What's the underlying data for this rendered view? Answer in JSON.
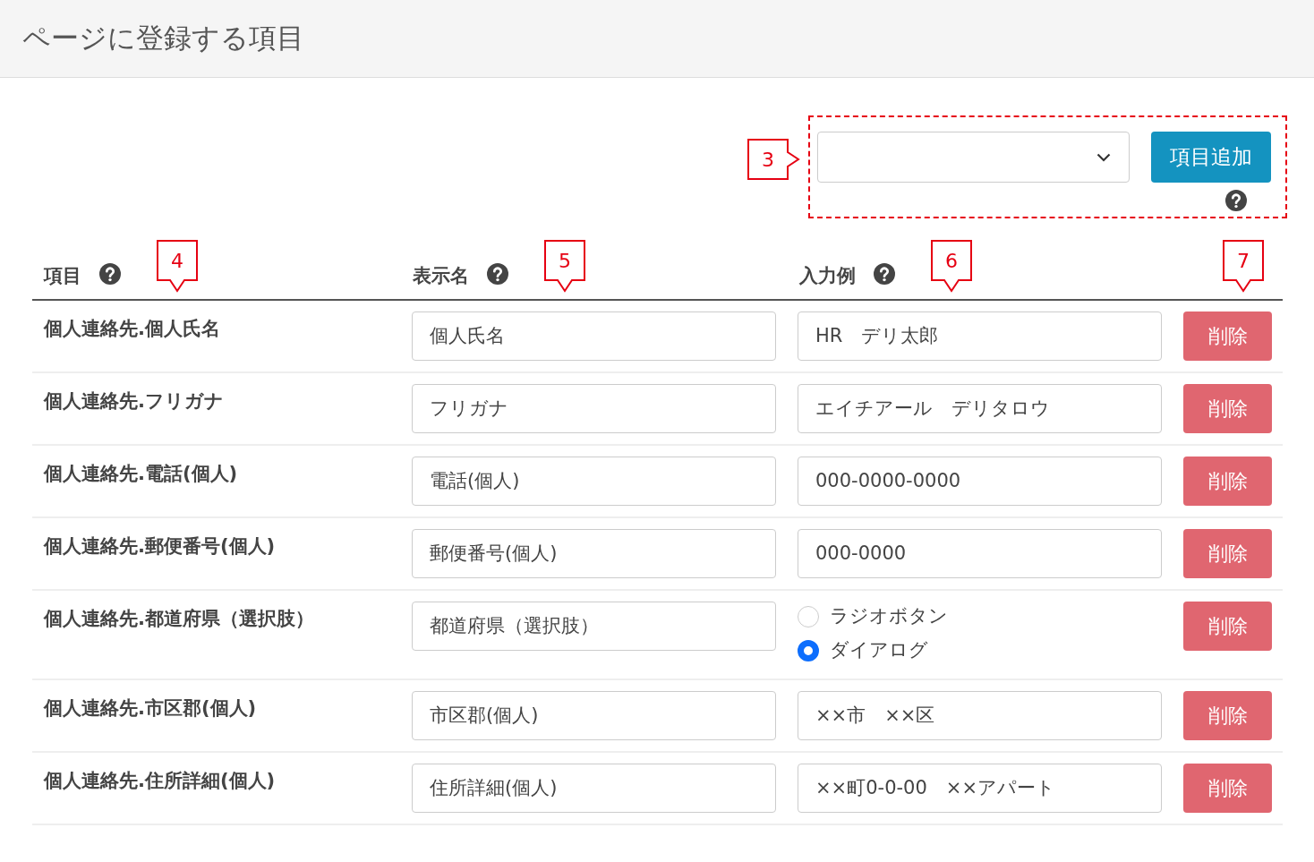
{
  "header": {
    "title": "ページに登録する項目"
  },
  "toolbar": {
    "annotation": "3",
    "add_button": "項目追加"
  },
  "columns": [
    {
      "label": "項目",
      "annotation": "4"
    },
    {
      "label": "表示名",
      "annotation": "5"
    },
    {
      "label": "入力例",
      "annotation": "6"
    },
    {
      "annotation": "7"
    }
  ],
  "rows": [
    {
      "item": "個人連絡先.個人氏名",
      "display_name": "個人氏名",
      "example": {
        "kind": "text",
        "value": "HR　デリ太郎"
      },
      "delete": "削除"
    },
    {
      "item": "個人連絡先.フリガナ",
      "display_name": "フリガナ",
      "example": {
        "kind": "text",
        "value": "エイチアール　デリタロウ"
      },
      "delete": "削除"
    },
    {
      "item": "個人連絡先.電話(個人)",
      "display_name": "電話(個人)",
      "example": {
        "kind": "text",
        "value": "000-0000-0000"
      },
      "delete": "削除"
    },
    {
      "item": "個人連絡先.郵便番号(個人)",
      "display_name": "郵便番号(個人)",
      "example": {
        "kind": "text",
        "value": "000-0000"
      },
      "delete": "削除"
    },
    {
      "item": "個人連絡先.都道府県（選択肢）",
      "display_name": "都道府県（選択肢）",
      "example": {
        "kind": "radio",
        "options": [
          {
            "label": "ラジオボタン",
            "selected": false
          },
          {
            "label": "ダイアログ",
            "selected": true
          }
        ]
      },
      "delete": "削除"
    },
    {
      "item": "個人連絡先.市区郡(個人)",
      "display_name": "市区郡(個人)",
      "example": {
        "kind": "text",
        "value": "××市　××区"
      },
      "delete": "削除"
    },
    {
      "item": "個人連絡先.住所詳細(個人)",
      "display_name": "住所詳細(個人)",
      "example": {
        "kind": "text",
        "value": "××町0-0-00　××アパート"
      },
      "delete": "削除"
    }
  ]
}
